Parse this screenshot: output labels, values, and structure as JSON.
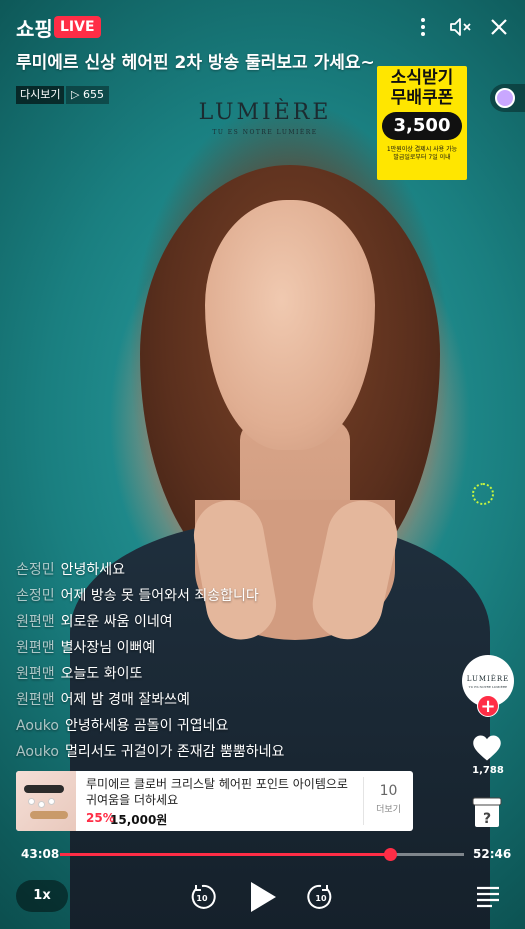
{
  "header": {
    "logo_text": "쇼핑",
    "live_badge": "LIVE",
    "title": "루미에르 신상 헤어핀 2차 방송 둘러보고 가세요~",
    "replay_label": "다시보기",
    "viewer_count": "▷ 655",
    "icons": [
      "more-vertical-icon",
      "mute-icon",
      "close-icon"
    ]
  },
  "brand_overlay": {
    "name": "LUMIÈRE",
    "tagline": "TU ES NOTRE LUMIÈRE"
  },
  "coupon": {
    "line1": "소식받기",
    "line2": "무배쿠폰",
    "amount": "3,500",
    "note_line1": "1만원이상 결제시 사용 가능",
    "note_line2": "발급일로부터 7일 이내",
    "color": "#ffe600"
  },
  "chat": [
    {
      "user": "손정민",
      "message": "안녕하세요"
    },
    {
      "user": "손정민",
      "message": "어제 방송 못 들어와서 죄송합니다"
    },
    {
      "user": "원편맨",
      "message": "외로운 싸움 이네여"
    },
    {
      "user": "원편맨",
      "message": "별사장님 이뻐예"
    },
    {
      "user": "원편맨",
      "message": "오늘도 화이또"
    },
    {
      "user": "원편맨",
      "message": "어제 밤 경매 잘봐쓰예"
    },
    {
      "user": "Aouko",
      "message": "안녕하세용 곰돌이 귀엽네요"
    },
    {
      "user": "Aouko",
      "message": "멀리서도 귀걸이가 존재감 뿜뿜하네요"
    }
  ],
  "side": {
    "store_name": "LUMIÈRE",
    "store_tagline": "TU ES NOTRE LUMIÈRE",
    "follow_label": "+",
    "like_count": "1,788",
    "quiz_label": "?"
  },
  "product": {
    "name": "루미에르 클로버 크리스탈 헤어핀 포인트 아이템으로 귀여움을 더하세요",
    "discount": "25%",
    "price": "15,000원",
    "more_count": "10",
    "more_label": "더보기"
  },
  "player": {
    "elapsed": "43:08",
    "duration": "52:46",
    "progress_fraction": 0.8175,
    "speed": "1x",
    "skip_back": "10",
    "skip_forward": "10",
    "accent_color": "#ff2d46"
  }
}
